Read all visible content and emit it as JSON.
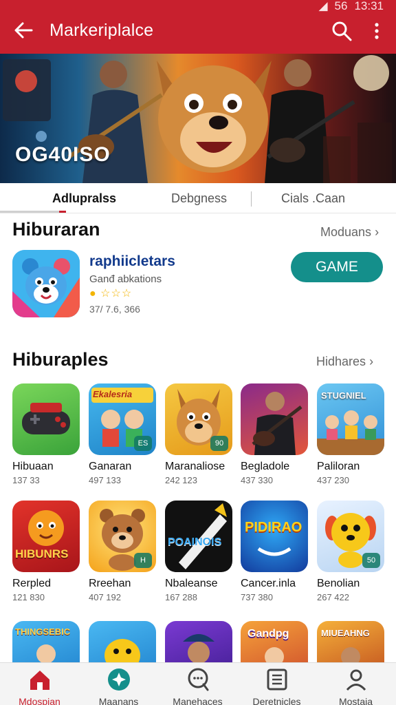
{
  "status_bar": {
    "signal": "56",
    "time": "13:31"
  },
  "app_bar": {
    "title": "Markeriplalce"
  },
  "banner": {
    "text": "OG40ISO"
  },
  "tabs": [
    {
      "label": "Adlupralss",
      "active": true
    },
    {
      "label": "Debgness",
      "active": false
    },
    {
      "label": "Cials .Caan",
      "active": false
    }
  ],
  "section1": {
    "title": "Hiburaran",
    "link": "Moduans",
    "featured": {
      "name": "raphiicletars",
      "subtitle": "Ganđ abkations",
      "stars": "☆☆☆",
      "count": "37/ 7.6, 366",
      "button": "GAME"
    }
  },
  "section2": {
    "title": "Hiburaples",
    "link": "Hidhares",
    "row1": [
      {
        "name": "Hibuaan",
        "count": "137 33",
        "icon": "gamepad-icon"
      },
      {
        "name": "Ganaran",
        "count": "497 133",
        "icon": "kids-cartoon-icon",
        "icon_text": "Ekalesria",
        "badge": "ES"
      },
      {
        "name": "Maranaliose",
        "count": "242 123",
        "icon": "kangaroo-icon",
        "badge": "90"
      },
      {
        "name": "Begladole",
        "count": "437 330",
        "icon": "guitarist-icon"
      },
      {
        "name": "Paliloran",
        "count": "437 230",
        "icon": "studio-kids-icon",
        "icon_text": "STUGNIEL"
      }
    ],
    "row2": [
      {
        "name": "Rerpled",
        "count": "121 830",
        "icon": "lion-cub-icon",
        "icon_text": "HIBUNRS"
      },
      {
        "name": "Rreehan",
        "count": "407 192",
        "icon": "bear-icon",
        "badge": "H"
      },
      {
        "name": "Nbaleanse",
        "count": "167 288",
        "icon": "chalk-icon",
        "icon_text": "POAINOIS"
      },
      {
        "name": "Cancer.inla",
        "count": "737 380",
        "icon": "pidirao-icon",
        "icon_text": "PIDIRAO"
      },
      {
        "name": "Benolian",
        "count": "267 422",
        "icon": "puppy-icon",
        "badge": "50"
      }
    ],
    "row3": [
      {
        "icon": "thingsebic-icon",
        "icon_text": "THINGSEBIC"
      },
      {
        "icon": "yellow-mascot-icon"
      },
      {
        "icon": "hat-boy-icon"
      },
      {
        "icon": "gandpg-icon",
        "icon_text": "Gandpg"
      },
      {
        "icon": "miueahng-icon",
        "icon_text": "MIUEAHNG"
      }
    ]
  },
  "bottom_nav": [
    {
      "label": "Mdospian",
      "icon": "home-icon",
      "active": true
    },
    {
      "label": "Maanans",
      "icon": "compass-icon",
      "active": false
    },
    {
      "label": "Manehaces",
      "icon": "chat-search-icon",
      "active": false
    },
    {
      "label": "Deretnicles",
      "icon": "list-icon",
      "active": false
    },
    {
      "label": "Mostaia",
      "icon": "profile-icon",
      "active": false
    }
  ],
  "colors": {
    "accent": "#c8202e",
    "button": "#148f8b"
  }
}
